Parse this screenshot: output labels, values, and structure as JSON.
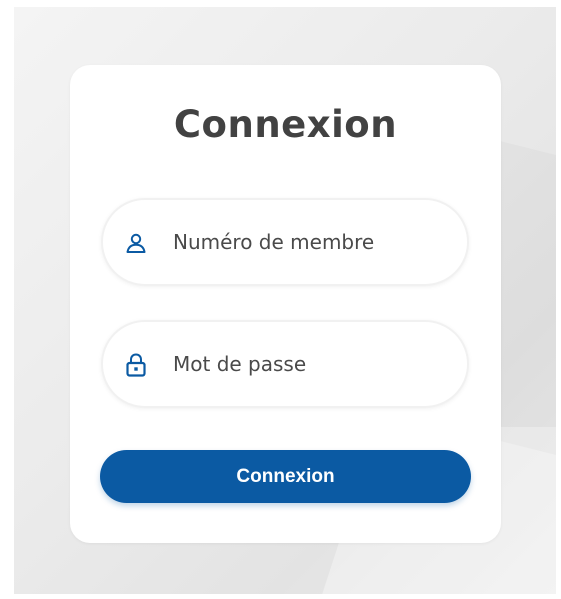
{
  "login": {
    "title": "Connexion",
    "member_field": {
      "placeholder": "Numéro de membre",
      "value": "",
      "icon": "user-icon"
    },
    "password_field": {
      "placeholder": "Mot de passe",
      "value": "",
      "icon": "lock-icon"
    },
    "submit_label": "Connexion"
  },
  "colors": {
    "accent": "#0b5aa3",
    "title": "#424242",
    "field_text": "#4a4a4a",
    "card": "#ffffff",
    "background": "#ebebeb"
  }
}
